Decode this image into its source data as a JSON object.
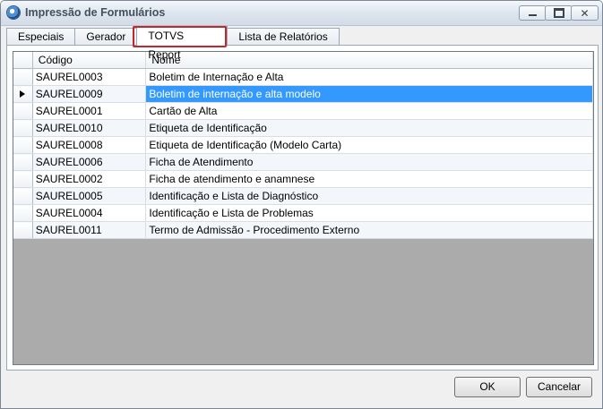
{
  "window": {
    "title": "Impressão de Formulários"
  },
  "tabs": [
    {
      "label": "Especiais"
    },
    {
      "label": "Gerador"
    },
    {
      "label": "TOTVS Report"
    },
    {
      "label": "Lista de Relatórios"
    }
  ],
  "grid": {
    "columns": {
      "codigo": "Código",
      "nome": "Nome"
    },
    "rows": [
      {
        "codigo": "SAUREL0003",
        "nome": "Boletim de Internação e Alta"
      },
      {
        "codigo": "SAUREL0009",
        "nome": "Boletim de internação e alta modelo"
      },
      {
        "codigo": "SAUREL0001",
        "nome": "Cartão de Alta"
      },
      {
        "codigo": "SAUREL0010",
        "nome": "Etiqueta de Identificação"
      },
      {
        "codigo": "SAUREL0008",
        "nome": "Etiqueta de Identificação (Modelo Carta)"
      },
      {
        "codigo": "SAUREL0006",
        "nome": "Ficha de Atendimento"
      },
      {
        "codigo": "SAUREL0002",
        "nome": "Ficha de atendimento e anamnese"
      },
      {
        "codigo": "SAUREL0005",
        "nome": "Identificação e Lista de Diagnóstico"
      },
      {
        "codigo": "SAUREL0004",
        "nome": "Identificação e Lista de Problemas"
      },
      {
        "codigo": "SAUREL0011",
        "nome": "Termo de Admissão - Procedimento Externo"
      }
    ]
  },
  "buttons": {
    "ok": "OK",
    "cancel": "Cancelar"
  },
  "colors": {
    "selection": "#3399ff",
    "highlight_box": "#c4262e"
  }
}
